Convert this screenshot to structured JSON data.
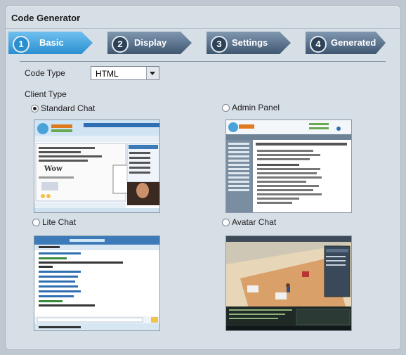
{
  "window": {
    "title": "Code Generator"
  },
  "steps": [
    {
      "num": "1",
      "label": "Basic",
      "active": true
    },
    {
      "num": "2",
      "label": "Display",
      "active": false
    },
    {
      "num": "3",
      "label": "Settings",
      "active": false
    },
    {
      "num": "4",
      "label": "Generated",
      "active": false
    }
  ],
  "code_type": {
    "label": "Code Type",
    "value": "HTML"
  },
  "client_type": {
    "label": "Client Type",
    "options": [
      {
        "label": "Standard Chat",
        "selected": true
      },
      {
        "label": "Admin Panel",
        "selected": false
      },
      {
        "label": "Lite Chat",
        "selected": false
      },
      {
        "label": "Avatar Chat",
        "selected": false
      }
    ]
  },
  "colors": {
    "active_step": "#2a8fd0",
    "inactive_step": "#4b6480",
    "panel": "#d6dee6"
  }
}
